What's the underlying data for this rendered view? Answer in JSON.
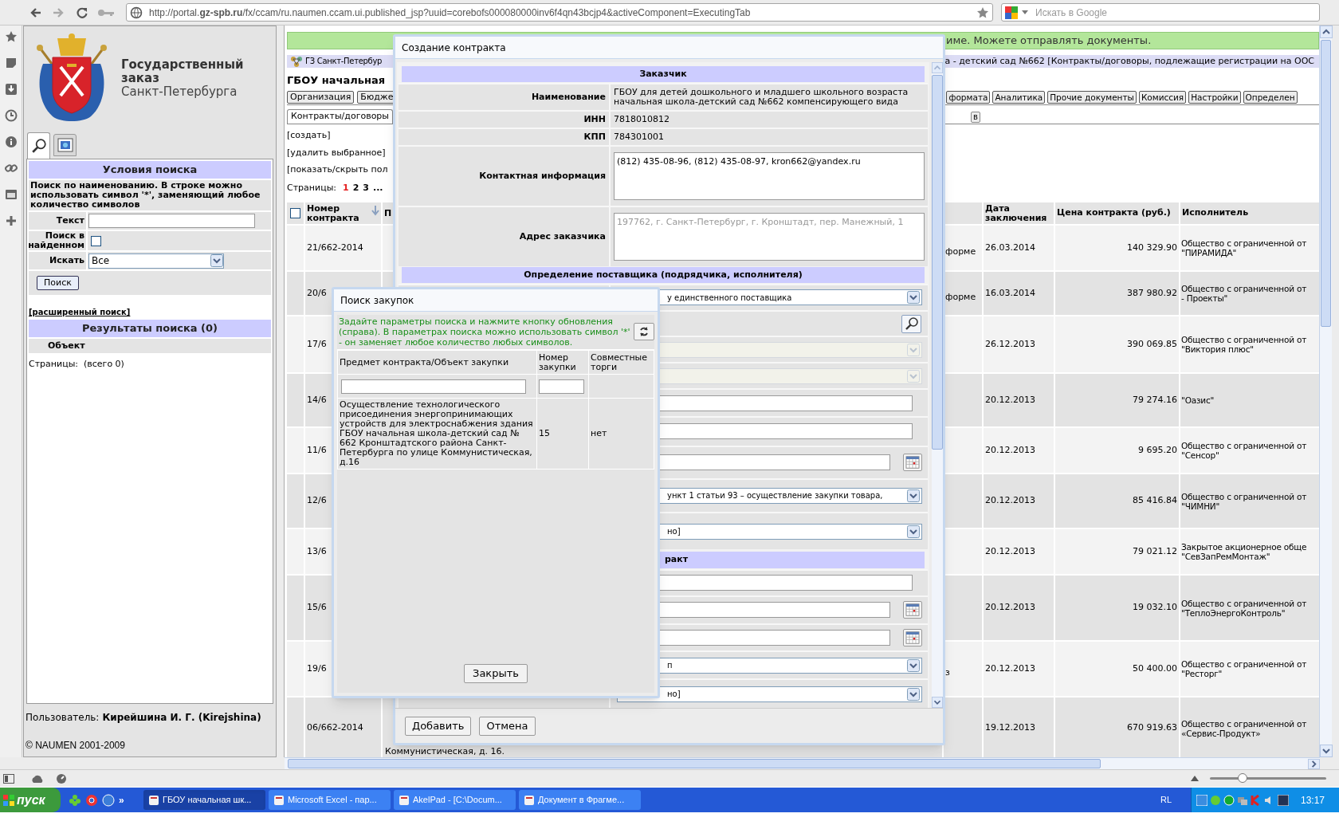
{
  "browser": {
    "url": "http://portal.**gz-spb.ru**/fx/ccam/ru.naumen.ccam.ui.published_jsp?uuid=corebofs000080000inv6f4qn43bcjp4&activeComponent=ExecutingTab",
    "search_placeholder": "Искать в Google"
  },
  "left_panel": {
    "logo": {
      "title_line_1": "Государственный",
      "title_line_2": "заказ",
      "subtitle": "Санкт-Петербурга"
    },
    "tabs": [
      {
        "kind": "search",
        "selected": true
      },
      {
        "kind": "image",
        "selected": false
      }
    ],
    "search_title": "Условия поиска",
    "search_hint": "Поиск по наименованию. В строке можно использовать символ '*', заменяющий любое количество символов",
    "fields": [
      {
        "kind": "text",
        "label": "Текст"
      },
      {
        "kind": "checkbox",
        "label": "Поиск в найденном",
        "checked": false
      },
      {
        "kind": "select",
        "label": "Искать",
        "value": "Все"
      }
    ],
    "search_button": "Поиск",
    "advanced_link": "[расширенный поиск]",
    "results_title": "Результаты поиска (0)",
    "results_column": "Объект",
    "pages": "Страницы:  (всего 0)",
    "user_label": "Пользователь:",
    "user_name": "Кирейшина И. Г. (Kirejshina)",
    "copyright": "© NAUMEN 2001-2009"
  },
  "main": {
    "notice": "име. Можете отправлять документы.",
    "breadcrumb_left": "ГЗ Санкт-Петербур",
    "breadcrumb_right": "а - детский сад №662 [Контракты/договоры, подлежащие регистрации на ООС",
    "heading": "ГБОУ начальная",
    "tabs_left": [
      "Организация",
      "Бюдже"
    ],
    "tabs_right": [
      "формата",
      "Аналитика",
      "Прочие документы",
      "Комиссия",
      "Настройки",
      "Определен"
    ],
    "subtab": "Контракты/договоры",
    "subtab_right": "в",
    "actions": [
      "[создать]",
      "[удалить выбранное]",
      "[показать/скрыть пол"
    ],
    "pages_label": "Страницы:",
    "pages": [
      {
        "label": "1",
        "selected": true
      },
      {
        "label": "2",
        "selected": false
      },
      {
        "label": "3",
        "selected": false
      },
      {
        "label": "...",
        "selected": false
      }
    ],
    "table": {
      "select_all_checked": false,
      "columns": {
        "number": "Номер контракта",
        "column_3": "П",
        "date": "Дата заключения",
        "price": "Цена контракта (руб.)",
        "executor": "Исполнитель"
      },
      "rows": [
        {
          "number": "21/662-2014",
          "column_4": "форме",
          "date": "26.03.2014",
          "price": "140 329.90",
          "executor": "Общество с ограниченной от\n\"ПИРАМИДА\""
        },
        {
          "number": "20/6",
          "column_4": "форме",
          "date": "16.03.2014",
          "price": "387 980.92",
          "executor": "Общество с ограниченной от\n- Проекты\""
        },
        {
          "number": "17/6",
          "date": "26.12.2013",
          "price": "390 069.85",
          "executor": "Общество с ограниченной от\n\"Виктория плюс\""
        },
        {
          "number": "14/6",
          "date": "20.12.2013",
          "price": "79 274.16",
          "executor": "\"Оазис\""
        },
        {
          "number": "11/6",
          "date": "20.12.2013",
          "price": "9 695.20",
          "executor": "Общество с ограниченной от\n\"Сенсор\""
        },
        {
          "number": "12/6",
          "date": "20.12.2013",
          "price": "85 416.84",
          "executor": "Общество с ограниченной от\n\"ЧИМНИ\""
        },
        {
          "number": "13/6",
          "date": "20.12.2013",
          "price": "79 021.12",
          "executor": "Закрытое акционерное обще\n\"СевЗапРемМонтаж\""
        },
        {
          "number": "15/6",
          "date": "20.12.2013",
          "price": "19 032.10",
          "executor": "Общество с ограниченной от\n\"ТеплоЭнергоКонтроль\""
        },
        {
          "number": "19/6",
          "column_4": "з",
          "date": "20.12.2013",
          "price": "50 400.00",
          "executor": "Общество с ограниченной от\n\"Ресторг\""
        },
        {
          "number": "06/662-2014",
          "column_3": "Коммунистическая, д. 16.",
          "date": "19.12.2013",
          "price": "670 919.63",
          "executor": "Общество с ограниченной от\n«Сервис-Продукт»"
        }
      ]
    }
  },
  "create_dialog": {
    "title": "Создание контракта",
    "customer_header": "Заказчик",
    "customer_rows": [
      {
        "kind": "text",
        "label": "Наименование",
        "value": "ГБОУ для детей дошкольного и младшего школьного возраста начальная школа-детский сад №662 компенсирующего вида"
      },
      {
        "kind": "text",
        "label": "ИНН",
        "value": "7818010812"
      },
      {
        "kind": "text",
        "label": "КПП",
        "value": "784301001"
      },
      {
        "kind": "textarea",
        "label": "Контактная информация",
        "value": "(812) 435-08-96, (812) 435-08-97, kron662@yandex.ru",
        "disabled": false
      },
      {
        "kind": "textarea",
        "label": "Адрес заказчика",
        "value": "197762, г. Санкт-Петербург, г. Кронштадт, пер. Манежный, 1",
        "disabled": true
      }
    ],
    "supplier_header": "Определение поставщика (подрядчика, исполнителя)",
    "lower_rows": [
      {
        "kind": "select",
        "value": "у единственного поставщика",
        "disabled": false
      },
      {
        "kind": "search_button"
      },
      {
        "kind": "select",
        "disabled": true
      },
      {
        "kind": "select",
        "disabled": true
      },
      {
        "kind": "input"
      },
      {
        "kind": "input"
      },
      {
        "kind": "date"
      },
      {
        "kind": "select",
        "value": "ункт 1 статьи 93 – осуществление закупки товара,",
        "disabled": false
      },
      {
        "kind": "select",
        "value": "но]",
        "disabled": false
      },
      {
        "kind": "header",
        "value": "ракт"
      },
      {
        "kind": "input"
      },
      {
        "kind": "date"
      },
      {
        "kind": "date"
      },
      {
        "kind": "select",
        "value": "п",
        "disabled": false
      },
      {
        "kind": "select",
        "value": "но]",
        "disabled": false
      }
    ],
    "buttons": [
      "Добавить",
      "Отмена"
    ]
  },
  "search_dialog": {
    "title": "Поиск закупок",
    "hint": "Задайте параметры поиска и нажмите кнопку обновления (справа). В параметрах поиска можно использовать символ '*' - он заменяет любое количество любых символов.",
    "columns": [
      "Предмет контракта/Объект закупки",
      "Номер закупки",
      "Совместные торги"
    ],
    "rows": [
      [
        "Осуществление технологического присоединения энергопринимающих устройств для электроснабжения здания ГБОУ начальная школа-детский сад № 662 Кронштадтского района Санкт-Петербурга по улице Коммунистическая, д.16",
        "15",
        "нет"
      ]
    ],
    "close_button": "Закрыть"
  },
  "status_bar": {
    "zoom_slider": {
      "level": 0.28
    }
  },
  "taskbar": {
    "start": "пуск",
    "quick_launch_more": "»",
    "tasks": [
      {
        "label": "ГБОУ начальная шк...",
        "selected": true
      },
      {
        "label": "Microsoft Excel - пар...",
        "selected": false
      },
      {
        "label": "AkelPad - [C:\\Docum...",
        "selected": false
      },
      {
        "label": "Документ в Фрагме...",
        "selected": false
      }
    ],
    "language": "RL",
    "clock": "13:17"
  }
}
